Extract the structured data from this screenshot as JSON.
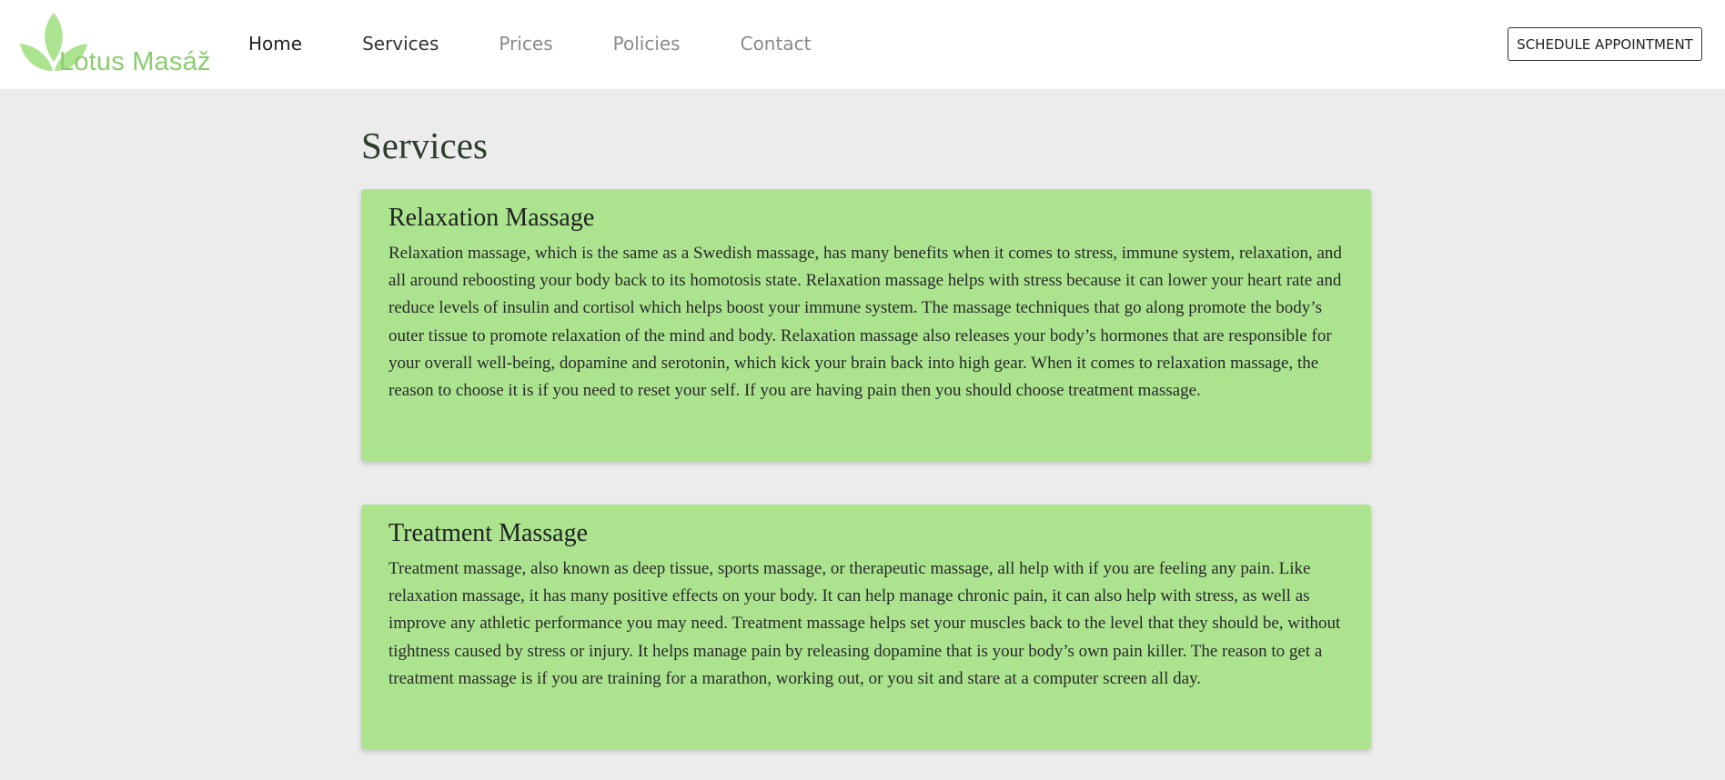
{
  "brand": {
    "name": "Lotus Masáž",
    "accent": "#8ccc6e"
  },
  "nav": {
    "items": [
      {
        "label": "Home"
      },
      {
        "label": "Services"
      },
      {
        "label": "Prices"
      },
      {
        "label": "Policies"
      },
      {
        "label": "Contact"
      }
    ],
    "cta_label": "SCHEDULE APPOINTMENT"
  },
  "main": {
    "title": "Services",
    "card_color": "#abe38f",
    "cards": [
      {
        "title": "Relaxation Massage",
        "body": "Relaxation massage, which is the same as a Swedish massage, has many benefits when it comes to stress, immune system, relaxation, and all around reboosting your body back to its homotosis state. Relaxation massage helps with stress because it can lower your heart rate and reduce levels of insulin and cortisol which helps boost your immune system. The massage techniques that go along promote the body’s outer tissue to promote relaxation of the mind and body. Relaxation massage also releases your body’s hormones that are responsible for your overall well-being, dopamine and serotonin, which kick your brain back into high gear. When it comes to relaxation massage, the reason to choose it is if you need to reset your self. If you are having pain then you should choose treatment massage."
      },
      {
        "title": "Treatment Massage",
        "body": "Treatment massage, also known as deep tissue, sports massage, or therapeutic massage, all help with if you are feeling any pain. Like relaxation massage, it has many positive effects on your body. It can help manage chronic pain, it can also help with stress, as well as improve any athletic performance you may need. Treatment massage helps set your muscles back to the level that they should be, without tightness caused by stress or injury. It helps manage pain by releasing dopamine that is your body’s own pain killer. The reason to get a treatment massage is if you are training for a marathon, working out, or you sit and stare at a computer screen all day."
      }
    ]
  }
}
